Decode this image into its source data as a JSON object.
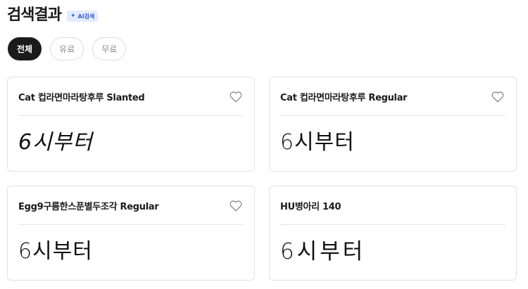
{
  "header": {
    "title": "검색결과",
    "ai_badge": "AI검색",
    "ai_badge_icon": "sparkle-icon"
  },
  "filters": [
    {
      "label": "전체",
      "active": true
    },
    {
      "label": "유료",
      "active": false
    },
    {
      "label": "무료",
      "active": false
    }
  ],
  "results": [
    {
      "name": "Cat 컵라면마라탕후루 Slanted",
      "preview": "6시부터",
      "favorite_icon": "heart-icon"
    },
    {
      "name": "Cat 컵라면마라탕후루 Regular",
      "preview": "6시부터",
      "favorite_icon": "heart-icon"
    },
    {
      "name": "Egg9구름한스푼별두조각 Regular",
      "preview": "6시부터",
      "favorite_icon": "heart-icon"
    },
    {
      "name": "HU병아리 140",
      "preview": "6시부터"
    }
  ],
  "colors": {
    "active_chip_bg": "#1b1b1b",
    "ai_badge_bg": "#e3ebff",
    "ai_badge_text": "#3d5bd9"
  }
}
